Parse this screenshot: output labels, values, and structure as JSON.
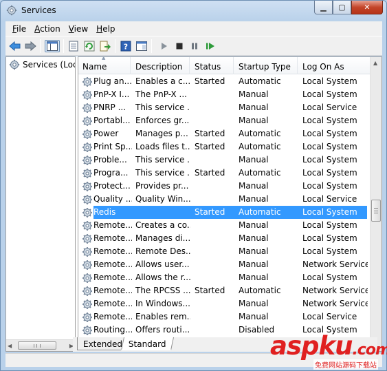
{
  "window": {
    "title": "Services"
  },
  "menu": [
    {
      "pre": "",
      "ul": "F",
      "post": "ile"
    },
    {
      "pre": "",
      "ul": "A",
      "post": "ction"
    },
    {
      "pre": "",
      "ul": "V",
      "post": "iew"
    },
    {
      "pre": "",
      "ul": "H",
      "post": "elp"
    }
  ],
  "tree": {
    "item": "Services (Local)"
  },
  "columns": [
    "Name",
    "Description",
    "Status",
    "Startup Type",
    "Log On As"
  ],
  "rows": [
    {
      "name": "Plug an...",
      "desc": "Enables a c...",
      "status": "Started",
      "startup": "Automatic",
      "logon": "Local System"
    },
    {
      "name": "PnP-X I...",
      "desc": "The PnP-X ...",
      "status": "",
      "startup": "Manual",
      "logon": "Local System"
    },
    {
      "name": "PNRP ...",
      "desc": "This service ...",
      "status": "",
      "startup": "Manual",
      "logon": "Local Service"
    },
    {
      "name": "Portabl...",
      "desc": "Enforces gr...",
      "status": "",
      "startup": "Manual",
      "logon": "Local System"
    },
    {
      "name": "Power",
      "desc": "Manages p...",
      "status": "Started",
      "startup": "Automatic",
      "logon": "Local System"
    },
    {
      "name": "Print Sp...",
      "desc": "Loads files t...",
      "status": "Started",
      "startup": "Automatic",
      "logon": "Local System"
    },
    {
      "name": "Proble...",
      "desc": "This service ...",
      "status": "",
      "startup": "Manual",
      "logon": "Local System"
    },
    {
      "name": "Progra...",
      "desc": "This service ...",
      "status": "Started",
      "startup": "Automatic",
      "logon": "Local System"
    },
    {
      "name": "Protect...",
      "desc": "Provides pr...",
      "status": "",
      "startup": "Manual",
      "logon": "Local System"
    },
    {
      "name": "Quality ...",
      "desc": "Quality Win...",
      "status": "",
      "startup": "Manual",
      "logon": "Local Service"
    },
    {
      "name": "Redis",
      "desc": "",
      "status": "Started",
      "startup": "Automatic",
      "logon": "Local System",
      "selected": true
    },
    {
      "name": "Remote...",
      "desc": "Creates a co...",
      "status": "",
      "startup": "Manual",
      "logon": "Local System"
    },
    {
      "name": "Remote...",
      "desc": "Manages di...",
      "status": "",
      "startup": "Manual",
      "logon": "Local System"
    },
    {
      "name": "Remote...",
      "desc": "Remote Des...",
      "status": "",
      "startup": "Manual",
      "logon": "Local System"
    },
    {
      "name": "Remote...",
      "desc": "Allows user...",
      "status": "",
      "startup": "Manual",
      "logon": "Network Service"
    },
    {
      "name": "Remote...",
      "desc": "Allows the r...",
      "status": "",
      "startup": "Manual",
      "logon": "Local System"
    },
    {
      "name": "Remote...",
      "desc": "The RPCSS ...",
      "status": "Started",
      "startup": "Automatic",
      "logon": "Network Service"
    },
    {
      "name": "Remote...",
      "desc": "In Windows...",
      "status": "",
      "startup": "Manual",
      "logon": "Network Service"
    },
    {
      "name": "Remote...",
      "desc": "Enables rem...",
      "status": "",
      "startup": "Manual",
      "logon": "Local Service"
    },
    {
      "name": "Routing...",
      "desc": "Offers routi...",
      "status": "",
      "startup": "Disabled",
      "logon": "Local System"
    }
  ],
  "tabs": [
    "Extended",
    "Standard"
  ],
  "watermark": {
    "brand": "aspku",
    "domain_suffix": ".com",
    "tagline": "免费网站源码下载站"
  },
  "colors": {
    "selection": "#3399ff",
    "watermark": "#e02020"
  }
}
